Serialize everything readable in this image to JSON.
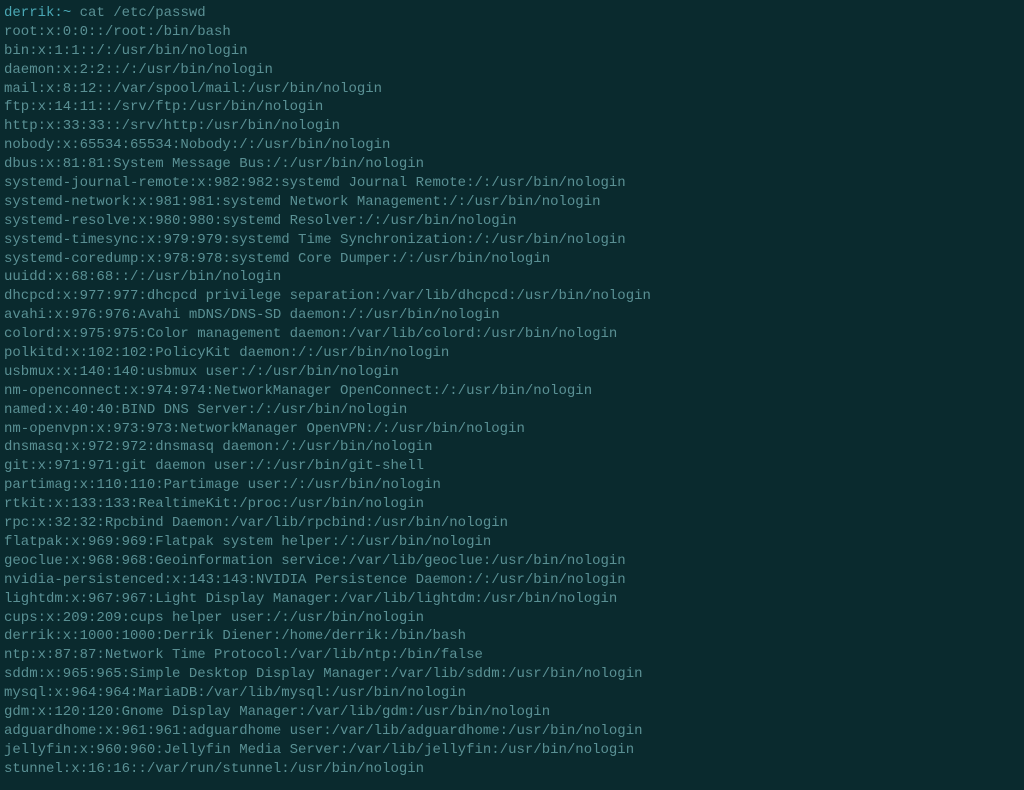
{
  "prompt": {
    "user": "derrik",
    "separator": ":",
    "path": "~",
    "command": "cat /etc/passwd"
  },
  "output": [
    "root:x:0:0::/root:/bin/bash",
    "bin:x:1:1::/:/usr/bin/nologin",
    "daemon:x:2:2::/:/usr/bin/nologin",
    "mail:x:8:12::/var/spool/mail:/usr/bin/nologin",
    "ftp:x:14:11::/srv/ftp:/usr/bin/nologin",
    "http:x:33:33::/srv/http:/usr/bin/nologin",
    "nobody:x:65534:65534:Nobody:/:/usr/bin/nologin",
    "dbus:x:81:81:System Message Bus:/:/usr/bin/nologin",
    "systemd-journal-remote:x:982:982:systemd Journal Remote:/:/usr/bin/nologin",
    "systemd-network:x:981:981:systemd Network Management:/:/usr/bin/nologin",
    "systemd-resolve:x:980:980:systemd Resolver:/:/usr/bin/nologin",
    "systemd-timesync:x:979:979:systemd Time Synchronization:/:/usr/bin/nologin",
    "systemd-coredump:x:978:978:systemd Core Dumper:/:/usr/bin/nologin",
    "uuidd:x:68:68::/:/usr/bin/nologin",
    "dhcpcd:x:977:977:dhcpcd privilege separation:/var/lib/dhcpcd:/usr/bin/nologin",
    "avahi:x:976:976:Avahi mDNS/DNS-SD daemon:/:/usr/bin/nologin",
    "colord:x:975:975:Color management daemon:/var/lib/colord:/usr/bin/nologin",
    "polkitd:x:102:102:PolicyKit daemon:/:/usr/bin/nologin",
    "usbmux:x:140:140:usbmux user:/:/usr/bin/nologin",
    "nm-openconnect:x:974:974:NetworkManager OpenConnect:/:/usr/bin/nologin",
    "named:x:40:40:BIND DNS Server:/:/usr/bin/nologin",
    "nm-openvpn:x:973:973:NetworkManager OpenVPN:/:/usr/bin/nologin",
    "dnsmasq:x:972:972:dnsmasq daemon:/:/usr/bin/nologin",
    "git:x:971:971:git daemon user:/:/usr/bin/git-shell",
    "partimag:x:110:110:Partimage user:/:/usr/bin/nologin",
    "rtkit:x:133:133:RealtimeKit:/proc:/usr/bin/nologin",
    "rpc:x:32:32:Rpcbind Daemon:/var/lib/rpcbind:/usr/bin/nologin",
    "flatpak:x:969:969:Flatpak system helper:/:/usr/bin/nologin",
    "geoclue:x:968:968:Geoinformation service:/var/lib/geoclue:/usr/bin/nologin",
    "nvidia-persistenced:x:143:143:NVIDIA Persistence Daemon:/:/usr/bin/nologin",
    "lightdm:x:967:967:Light Display Manager:/var/lib/lightdm:/usr/bin/nologin",
    "cups:x:209:209:cups helper user:/:/usr/bin/nologin",
    "derrik:x:1000:1000:Derrik Diener:/home/derrik:/bin/bash",
    "ntp:x:87:87:Network Time Protocol:/var/lib/ntp:/bin/false",
    "sddm:x:965:965:Simple Desktop Display Manager:/var/lib/sddm:/usr/bin/nologin",
    "mysql:x:964:964:MariaDB:/var/lib/mysql:/usr/bin/nologin",
    "gdm:x:120:120:Gnome Display Manager:/var/lib/gdm:/usr/bin/nologin",
    "adguardhome:x:961:961:adguardhome user:/var/lib/adguardhome:/usr/bin/nologin",
    "jellyfin:x:960:960:Jellyfin Media Server:/var/lib/jellyfin:/usr/bin/nologin",
    "stunnel:x:16:16::/var/run/stunnel:/usr/bin/nologin"
  ]
}
